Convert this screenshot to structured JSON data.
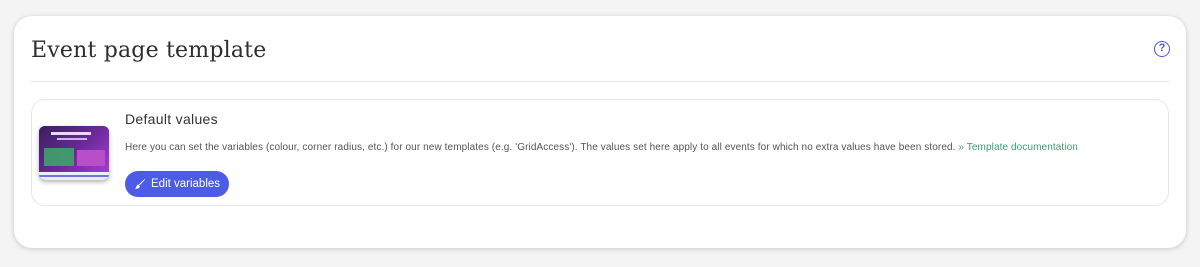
{
  "panel": {
    "title": "Event page template",
    "help_icon": "?"
  },
  "template": {
    "title": "Default values",
    "description": "Here you can set the variables (colour, corner radius, etc.) for our new templates (e.g. 'GridAccess'). The values set here apply to all events for which no extra values have been stored.",
    "doc_link": "» Template documentation",
    "edit_button": "Edit variables",
    "edit_icon": "brush-icon",
    "thumbnail_icon": "template-preview-thumbnail"
  },
  "colors": {
    "accent": "#4d5ce6",
    "link": "#3a9e6e"
  }
}
